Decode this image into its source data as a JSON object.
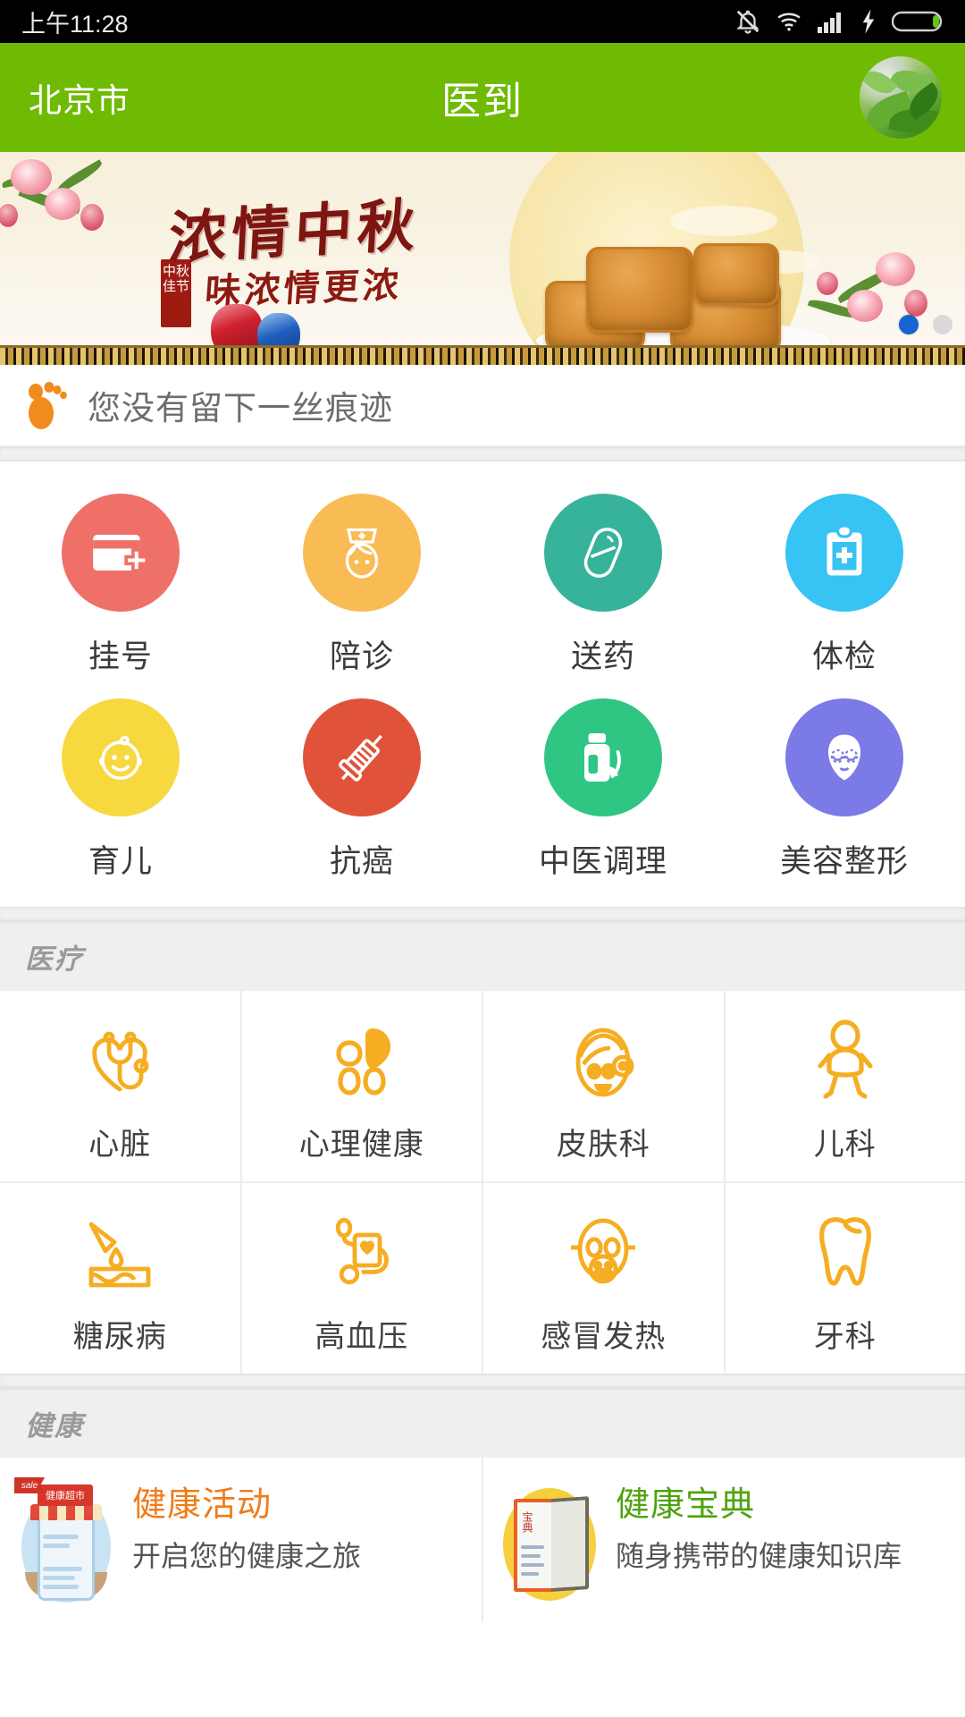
{
  "statusbar": {
    "time": "上午11:28",
    "icons": [
      "bell-muted-icon",
      "wifi-icon",
      "signal-icon",
      "charging-bolt-icon",
      "battery-icon"
    ]
  },
  "appbar": {
    "city": "北京市",
    "title": "医到",
    "avatar_alt": "用户头像",
    "bg_color": "#6fbb03"
  },
  "banner": {
    "headline": "浓情中秋",
    "subline": "味浓情更浓",
    "seal": "中秋佳节",
    "pager_active_color": "#1763d0",
    "pager_inactive_color": "#d9d9d9"
  },
  "trace": {
    "icon": "footprint-icon",
    "text": "您没有留下一丝痕迹",
    "icon_color": "#f08c1e"
  },
  "services": [
    [
      {
        "label": "挂号",
        "icon": "medical-card-icon",
        "color": "#ef7069"
      },
      {
        "label": "陪诊",
        "icon": "nurse-icon",
        "color": "#f9bb53"
      },
      {
        "label": "送药",
        "icon": "capsule-pill-icon",
        "color": "#36b39a"
      },
      {
        "label": "体检",
        "icon": "clipboard-health-icon",
        "color": "#37c3f3"
      }
    ],
    [
      {
        "label": "育儿",
        "icon": "baby-face-icon",
        "color": "#f7d githubusercontent"
      },
      {
        "label": "抗癌",
        "icon": "syringe-icon",
        "color": "#e0533a"
      },
      {
        "label": "中医调理",
        "icon": "herbal-bottle-icon",
        "color": "#2fc583"
      },
      {
        "label": "美容整形",
        "icon": "beauty-face-icon",
        "color": "#7b7ae6"
      }
    ]
  ],
  "medical": {
    "section_title": "医疗",
    "accent_color": "#f5ad21",
    "items": [
      {
        "label": "心脏",
        "icon": "heart-stethoscope-icon"
      },
      {
        "label": "心理健康",
        "icon": "mind-heart-icon"
      },
      {
        "label": "皮肤科",
        "icon": "facial-skin-icon"
      },
      {
        "label": "儿科",
        "icon": "infant-icon"
      },
      {
        "label": "糖尿病",
        "icon": "blood-drop-lancet-icon"
      },
      {
        "label": "高血压",
        "icon": "blood-pressure-monitor-icon"
      },
      {
        "label": "感冒发热",
        "icon": "face-mask-icon"
      },
      {
        "label": "牙科",
        "icon": "tooth-icon"
      }
    ]
  },
  "health": {
    "section_title": "健康",
    "cards": [
      {
        "title": "健康活动",
        "desc": "开启您的健康之旅",
        "title_color": "#f07c18",
        "icon": "health-supermarket-icon",
        "sign_text": "健康超市",
        "flag_text": "sale"
      },
      {
        "title": "健康宝典",
        "desc": "随身携带的健康知识库",
        "title_color": "#4fa30d",
        "icon": "handbook-icon",
        "book_text": "宝典"
      }
    ]
  }
}
